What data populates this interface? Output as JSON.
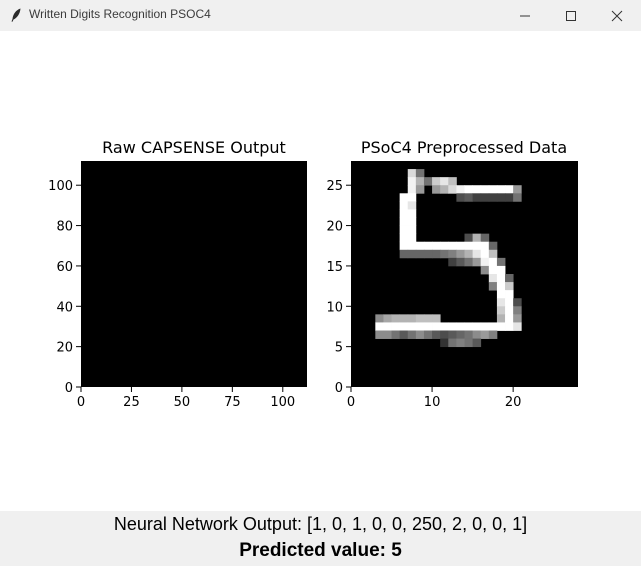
{
  "window": {
    "title": "Written Digits Recognition PSOC4",
    "app_icon": "feather-icon",
    "minimize_icon": "minimize-icon",
    "maximize_icon": "maximize-icon",
    "close_icon": "close-icon"
  },
  "chart_data": [
    {
      "type": "heatmap",
      "title": "Raw CAPSENSE Output",
      "colormap": "gray",
      "xlim": [
        0,
        112
      ],
      "ylim": [
        0,
        112
      ],
      "xticks": [
        "0",
        "25",
        "50",
        "75",
        "100"
      ],
      "yticks": [
        "0",
        "20",
        "40",
        "60",
        "80",
        "100"
      ],
      "values": "all zero (uniform black)"
    },
    {
      "type": "heatmap",
      "title": "PSoC4 Preprocessed Data",
      "colormap": "gray",
      "xlim": [
        0,
        28
      ],
      "ylim": [
        0,
        28
      ],
      "xticks": [
        "0",
        "10",
        "20"
      ],
      "yticks": [
        "0",
        "5",
        "10",
        "15",
        "20",
        "25"
      ],
      "pixels": [
        [
          7,
          26,
          0.85
        ],
        [
          8,
          26,
          0.45
        ],
        [
          7,
          25,
          0.95
        ],
        [
          8,
          25,
          0.7
        ],
        [
          9,
          25,
          0.45
        ],
        [
          10,
          25,
          0.8
        ],
        [
          11,
          25,
          0.9
        ],
        [
          12,
          25,
          0.75
        ],
        [
          7,
          24,
          0.95
        ],
        [
          8,
          24,
          0.6
        ],
        [
          10,
          24,
          0.6
        ],
        [
          11,
          24,
          0.7
        ],
        [
          12,
          24,
          0.85
        ],
        [
          13,
          24,
          0.95
        ],
        [
          14,
          24,
          1.0
        ],
        [
          15,
          24,
          1.0
        ],
        [
          16,
          24,
          1.0
        ],
        [
          17,
          24,
          1.0
        ],
        [
          18,
          24,
          1.0
        ],
        [
          19,
          24,
          1.0
        ],
        [
          20,
          24,
          0.6
        ],
        [
          6,
          23,
          1.0
        ],
        [
          7,
          23,
          1.0
        ],
        [
          13,
          23,
          0.3
        ],
        [
          14,
          23,
          0.35
        ],
        [
          15,
          23,
          0.25
        ],
        [
          16,
          23,
          0.25
        ],
        [
          17,
          23,
          0.25
        ],
        [
          18,
          23,
          0.25
        ],
        [
          19,
          23,
          0.25
        ],
        [
          20,
          23,
          0.45
        ],
        [
          6,
          22,
          1.0
        ],
        [
          7,
          22,
          0.9
        ],
        [
          6,
          21,
          1.0
        ],
        [
          7,
          21,
          1.0
        ],
        [
          6,
          20,
          1.0
        ],
        [
          7,
          20,
          1.0
        ],
        [
          6,
          19,
          1.0
        ],
        [
          7,
          19,
          1.0
        ],
        [
          6,
          18,
          1.0
        ],
        [
          7,
          18,
          1.0
        ],
        [
          14,
          18,
          0.3
        ],
        [
          15,
          18,
          0.7
        ],
        [
          16,
          18,
          0.4
        ],
        [
          6,
          17,
          1.0
        ],
        [
          7,
          17,
          1.0
        ],
        [
          8,
          17,
          1.0
        ],
        [
          9,
          17,
          1.0
        ],
        [
          10,
          17,
          1.0
        ],
        [
          11,
          17,
          1.0
        ],
        [
          12,
          17,
          1.0
        ],
        [
          13,
          17,
          1.0
        ],
        [
          14,
          17,
          1.0
        ],
        [
          15,
          17,
          1.0
        ],
        [
          16,
          17,
          1.0
        ],
        [
          17,
          17,
          0.4
        ],
        [
          6,
          16,
          0.4
        ],
        [
          7,
          16,
          0.4
        ],
        [
          8,
          16,
          0.4
        ],
        [
          9,
          16,
          0.4
        ],
        [
          10,
          16,
          0.4
        ],
        [
          11,
          16,
          0.45
        ],
        [
          12,
          16,
          0.5
        ],
        [
          13,
          16,
          0.6
        ],
        [
          14,
          16,
          0.7
        ],
        [
          15,
          16,
          0.9
        ],
        [
          16,
          16,
          1.0
        ],
        [
          17,
          16,
          0.75
        ],
        [
          12,
          15,
          0.25
        ],
        [
          13,
          15,
          0.35
        ],
        [
          14,
          15,
          0.45
        ],
        [
          15,
          15,
          0.6
        ],
        [
          16,
          15,
          0.95
        ],
        [
          17,
          15,
          1.0
        ],
        [
          18,
          15,
          0.45
        ],
        [
          16,
          14,
          0.55
        ],
        [
          17,
          14,
          1.0
        ],
        [
          18,
          14,
          1.0
        ],
        [
          17,
          13,
          0.9
        ],
        [
          18,
          13,
          1.0
        ],
        [
          19,
          13,
          0.4
        ],
        [
          17,
          12,
          0.5
        ],
        [
          18,
          12,
          1.0
        ],
        [
          19,
          12,
          0.8
        ],
        [
          18,
          11,
          1.0
        ],
        [
          19,
          11,
          1.0
        ],
        [
          18,
          10,
          0.9
        ],
        [
          19,
          10,
          1.0
        ],
        [
          20,
          10,
          0.3
        ],
        [
          18,
          9,
          0.8
        ],
        [
          19,
          9,
          1.0
        ],
        [
          20,
          9,
          0.5
        ],
        [
          3,
          8,
          0.55
        ],
        [
          4,
          8,
          0.65
        ],
        [
          5,
          8,
          0.7
        ],
        [
          6,
          8,
          0.7
        ],
        [
          7,
          8,
          0.7
        ],
        [
          8,
          8,
          0.75
        ],
        [
          9,
          8,
          0.75
        ],
        [
          10,
          8,
          0.75
        ],
        [
          18,
          8,
          0.7
        ],
        [
          19,
          8,
          1.0
        ],
        [
          20,
          8,
          0.6
        ],
        [
          3,
          7,
          1.0
        ],
        [
          4,
          7,
          1.0
        ],
        [
          5,
          7,
          1.0
        ],
        [
          6,
          7,
          1.0
        ],
        [
          7,
          7,
          1.0
        ],
        [
          8,
          7,
          1.0
        ],
        [
          9,
          7,
          1.0
        ],
        [
          10,
          7,
          1.0
        ],
        [
          11,
          7,
          1.0
        ],
        [
          12,
          7,
          1.0
        ],
        [
          13,
          7,
          1.0
        ],
        [
          14,
          7,
          1.0
        ],
        [
          15,
          7,
          1.0
        ],
        [
          16,
          7,
          1.0
        ],
        [
          17,
          7,
          1.0
        ],
        [
          18,
          7,
          1.0
        ],
        [
          19,
          7,
          1.0
        ],
        [
          20,
          7,
          0.9
        ],
        [
          3,
          6,
          0.55
        ],
        [
          4,
          6,
          0.55
        ],
        [
          5,
          6,
          0.45
        ],
        [
          6,
          6,
          0.35
        ],
        [
          7,
          6,
          0.45
        ],
        [
          8,
          6,
          0.55
        ],
        [
          9,
          6,
          0.45
        ],
        [
          10,
          6,
          0.35
        ],
        [
          11,
          6,
          0.3
        ],
        [
          12,
          6,
          0.35
        ],
        [
          13,
          6,
          0.4
        ],
        [
          14,
          6,
          0.45
        ],
        [
          15,
          6,
          0.55
        ],
        [
          16,
          6,
          0.6
        ],
        [
          17,
          6,
          0.5
        ],
        [
          11,
          5,
          0.2
        ],
        [
          12,
          5,
          0.45
        ],
        [
          13,
          5,
          0.5
        ],
        [
          14,
          5,
          0.45
        ],
        [
          15,
          5,
          0.35
        ]
      ]
    }
  ],
  "bottom": {
    "nn_output": "Neural Network Output: [1, 0, 1, 0, 0, 250, 2, 0, 0, 1]",
    "predicted": "Predicted value: 5"
  }
}
